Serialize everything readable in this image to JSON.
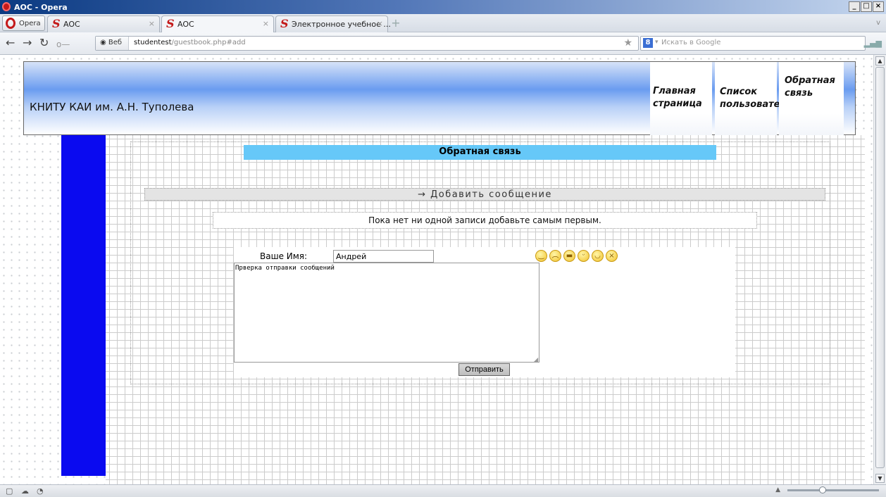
{
  "window": {
    "title": "AOC - Opera",
    "buttons": [
      "_",
      "ø",
      "×"
    ]
  },
  "opera_menu": {
    "label": "Opera"
  },
  "tabs": [
    {
      "label": "AOC",
      "active": false
    },
    {
      "label": "AOC",
      "active": true
    },
    {
      "label": "Электронное учебное ...",
      "active": false
    }
  ],
  "address_bar": {
    "badge": "Веб",
    "url_host": "studentest",
    "url_path": "/guestbook.php#add",
    "search_engine": "8",
    "search_placeholder": "Искать в Google"
  },
  "site": {
    "name": "КНИТУ КАИ им. А.Н. Туполева",
    "menu": [
      {
        "line1": "Главная",
        "line2": "страница"
      },
      {
        "line1": "Список",
        "line2": "пользователей"
      },
      {
        "line1": "Обратная",
        "line2": "связь"
      }
    ]
  },
  "page": {
    "title": "Обратная связь",
    "add_message": "→ Добавить сообщение",
    "empty_message": "Пока нет ни одной записи добавьте самым первым.",
    "form": {
      "name_label": "Ваше Имя:",
      "name_value": "Андрей",
      "message_value": "Прверка отправки сообщений",
      "submit_label": "Отправить",
      "smileys": [
        "smile",
        "sad",
        "cool",
        "tongue",
        "grin",
        "angry"
      ]
    }
  },
  "colors": {
    "sidebar": "#0a0af0",
    "title_band": "#66c8f8",
    "header_gradient": "#6a9cf0"
  }
}
